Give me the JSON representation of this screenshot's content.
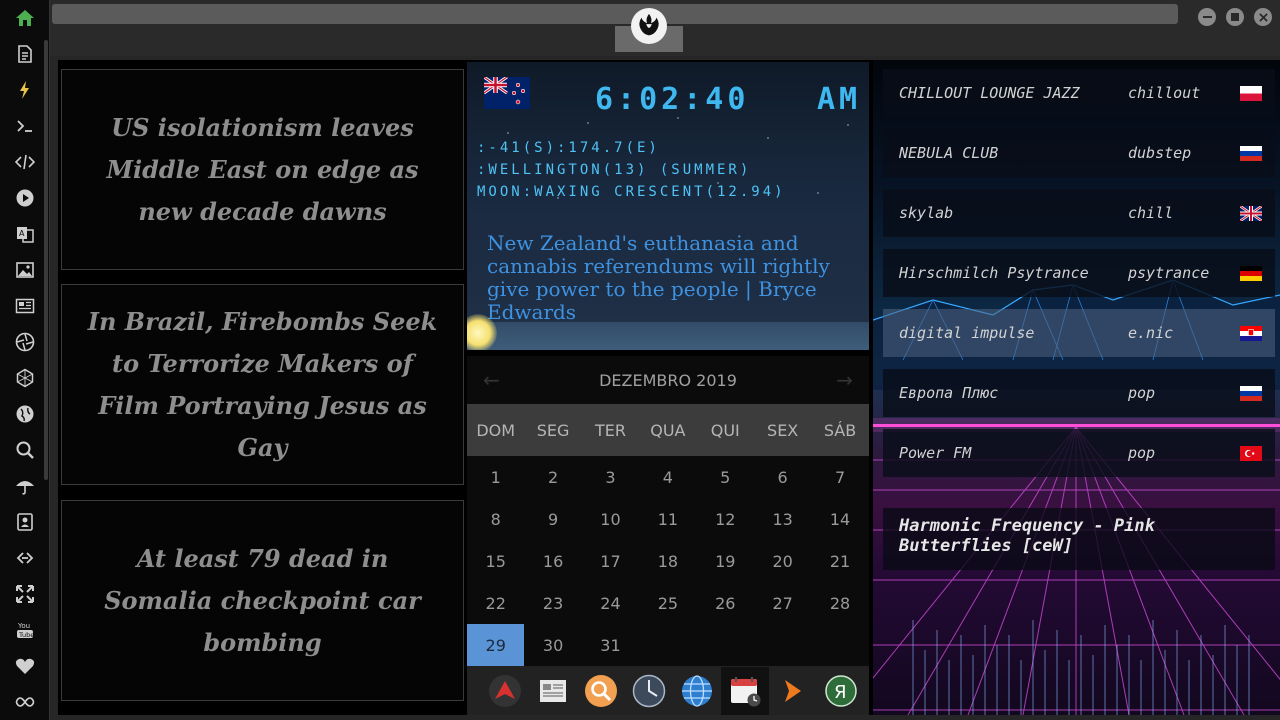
{
  "sidebar": {
    "icons": [
      "home-icon",
      "document-icon",
      "lightning-icon",
      "terminal-icon",
      "code-icon",
      "play-icon",
      "translate-icon",
      "image-icon",
      "newspaper-icon",
      "aperture-icon",
      "hexagon-icon",
      "globe-icon",
      "search-icon",
      "umbrella-icon",
      "contacts-icon",
      "link-icon",
      "expand-icon",
      "youtube-icon",
      "heart-icon",
      "infinity-icon"
    ],
    "accent": "#4caf50"
  },
  "news": [
    {
      "headline": "US isolationism leaves Middle East on edge as new decade dawns"
    },
    {
      "headline": "In Brazil, Firebombs Seek to Terrorize Makers of Film Portraying Jesus as Gay"
    },
    {
      "headline": "At least 79 dead in Somalia checkpoint car bombing"
    }
  ],
  "clock": {
    "time": "6:02:40",
    "ampm": "AM",
    "coords": ":-41(S):174.7(E)",
    "location": ":WELLINGTON(13) (SUMMER)",
    "moon": "MOON:WAXING CRESCENT(12.94)",
    "headline": "New Zealand's euthanasia and cannabis referendums will rightly give power to the people | Bryce Edwards",
    "color": "#3fb8f0"
  },
  "calendar": {
    "title": "DEZEMBRO 2019",
    "weekdays": [
      "DOM",
      "SEG",
      "TER",
      "QUA",
      "QUI",
      "SEX",
      "SÁB"
    ],
    "weeks": [
      [
        "1",
        "2",
        "3",
        "4",
        "5",
        "6",
        "7"
      ],
      [
        "8",
        "9",
        "10",
        "11",
        "12",
        "13",
        "14"
      ],
      [
        "15",
        "16",
        "17",
        "18",
        "19",
        "20",
        "21"
      ],
      [
        "22",
        "23",
        "24",
        "25",
        "26",
        "27",
        "28"
      ],
      [
        "29",
        "30",
        "31",
        "",
        "",
        "",
        ""
      ]
    ],
    "today": "29",
    "today_color": "#5b94d6"
  },
  "dock": {
    "items": [
      "arrow-app-icon",
      "news-reader-icon",
      "search-app-icon",
      "clock-app-icon",
      "browser-globe-icon",
      "calendar-app-icon",
      "play-arrow-icon",
      "yandex-icon"
    ],
    "active": "calendar-app-icon"
  },
  "radio": {
    "stations": [
      {
        "name": "CHILLOUT LOUNGE JAZZ",
        "genre": "chillout",
        "flag": "poland-flag"
      },
      {
        "name": "NEBULA CLUB",
        "genre": "dubstep",
        "flag": "russia-flag"
      },
      {
        "name": "skylab",
        "genre": "chill",
        "flag": "uk-flag"
      },
      {
        "name": "Hirschmilch Psytrance",
        "genre": "psytrance",
        "flag": "germany-flag"
      },
      {
        "name": "digital impulse",
        "genre": "e.nic",
        "flag": "croatia-flag"
      },
      {
        "name": "Европа Плюс",
        "genre": "pop",
        "flag": "russia-flag"
      },
      {
        "name": "Power FM",
        "genre": "pop",
        "flag": "turkey-flag"
      }
    ],
    "highlighted": "digital impulse",
    "now_playing": "Harmonic Frequency - Pink Butterflies [ceW]"
  }
}
